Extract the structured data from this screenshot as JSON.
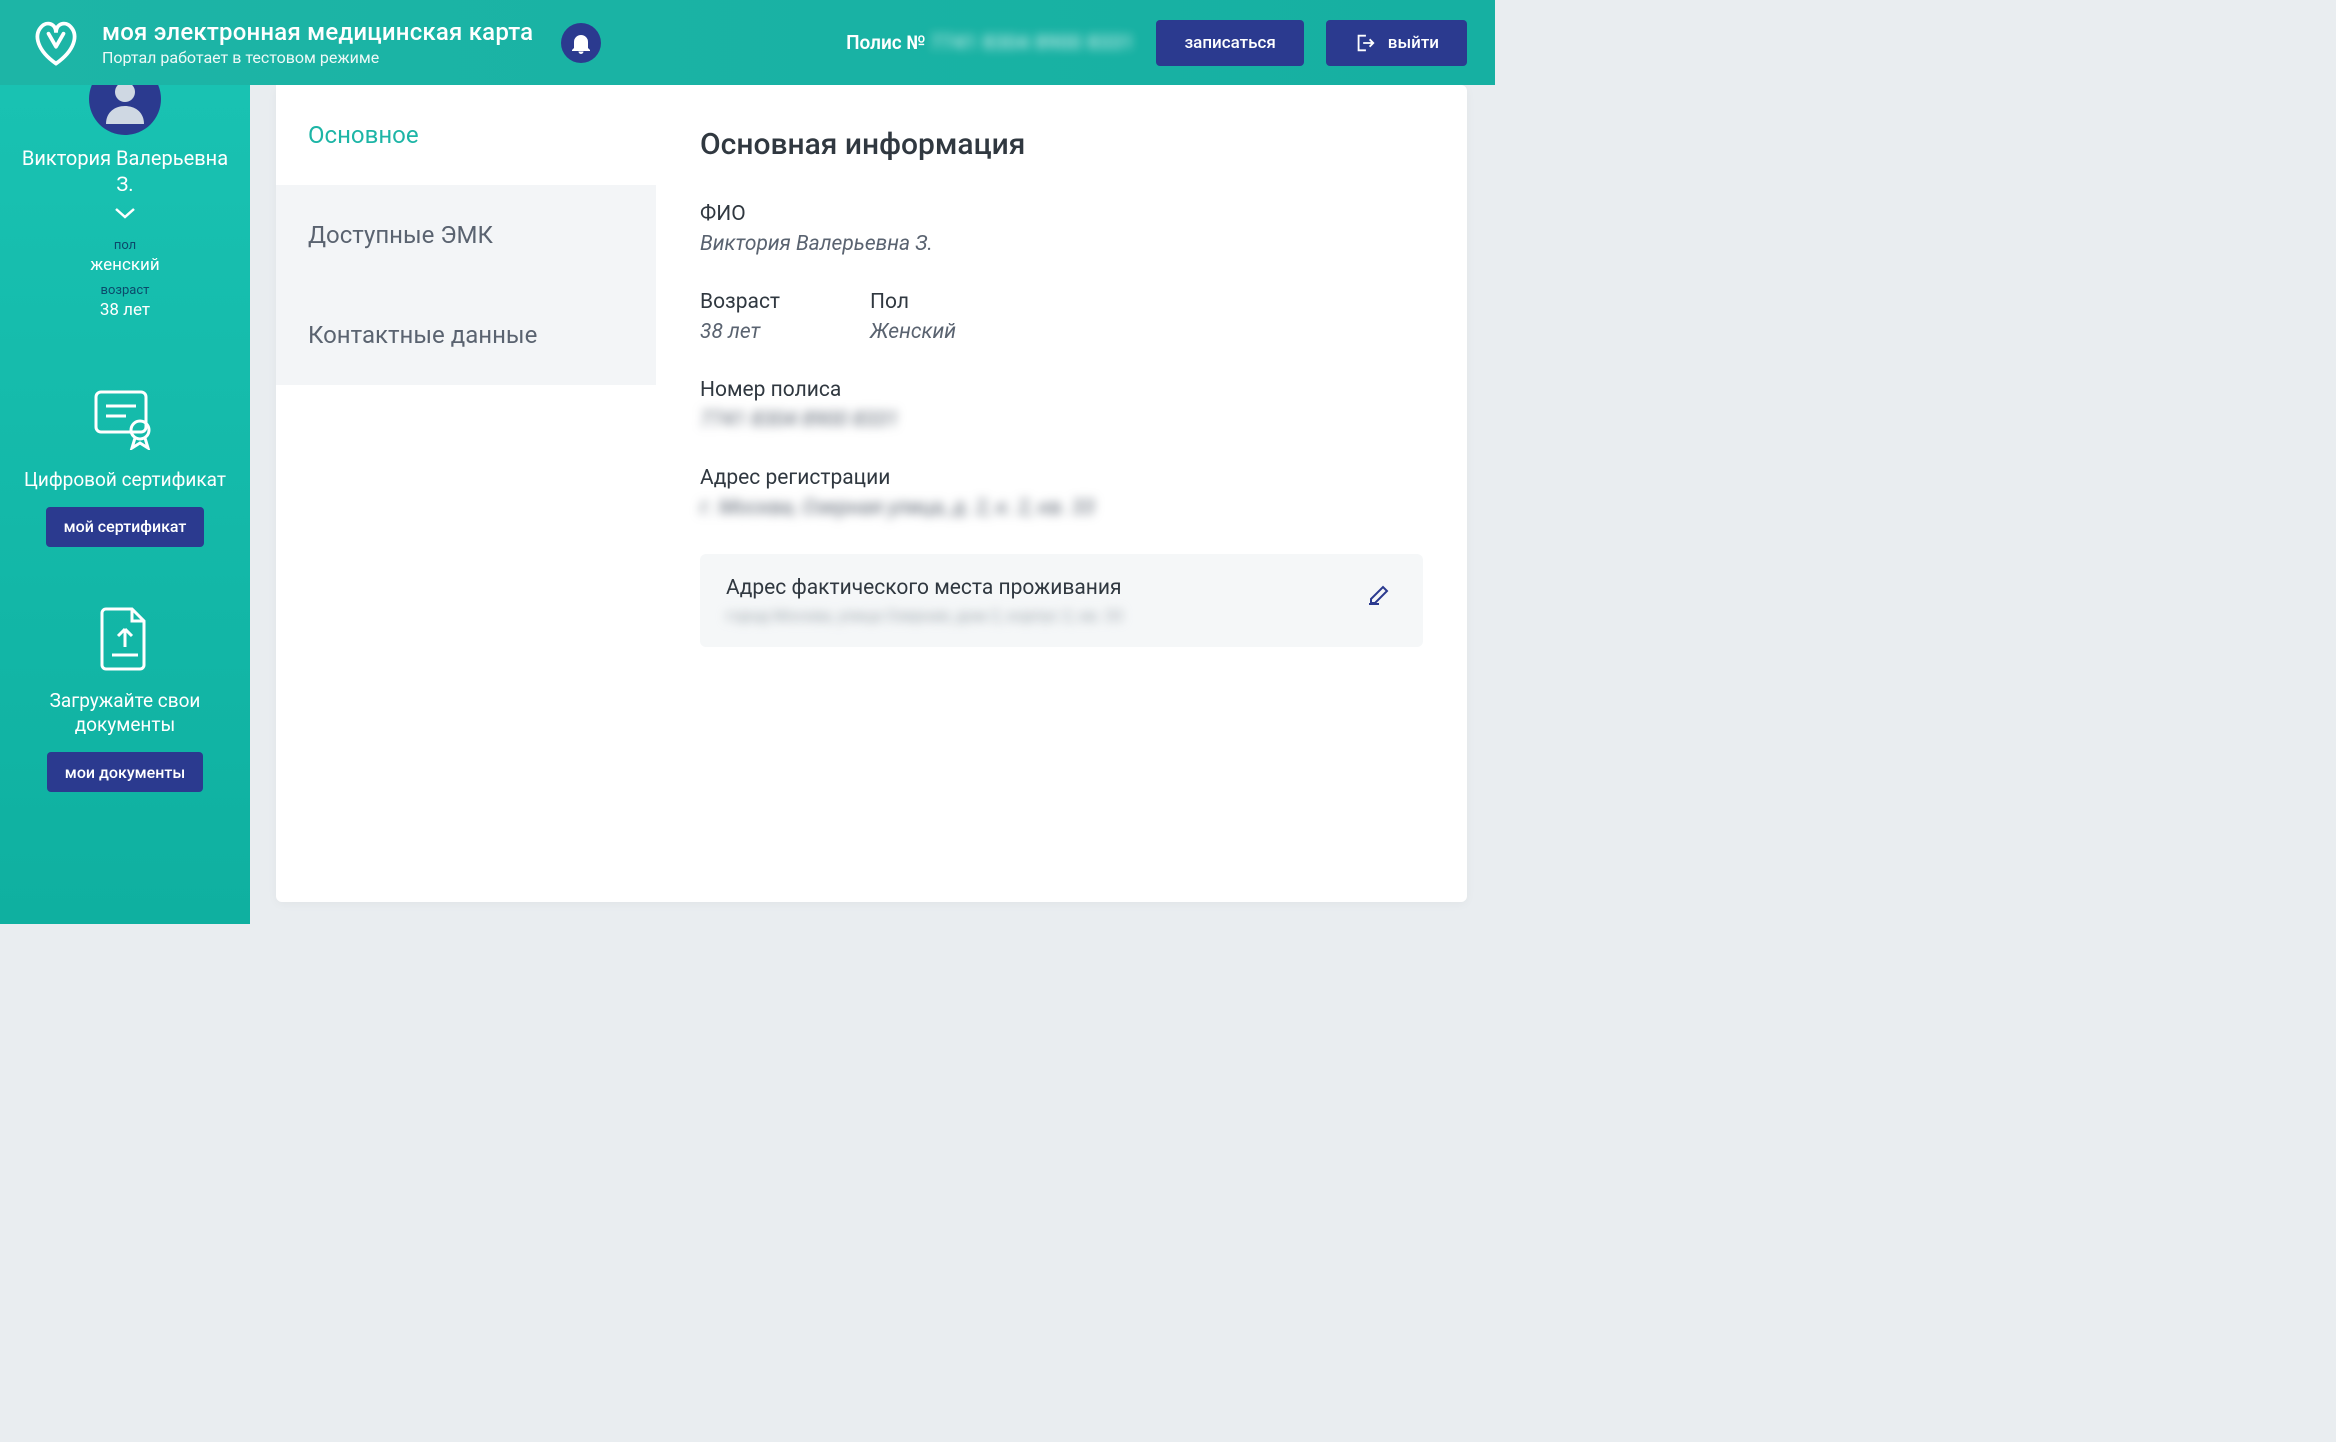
{
  "header": {
    "title": "моя электронная медицинская карта",
    "subtitle": "Портал работает в тестовом режиме",
    "policy_label": "Полис №",
    "policy_number": "7741 8304 8900 8331",
    "book_btn": "записаться",
    "logout_btn": "выйти"
  },
  "sidebar": {
    "user_name": "Виктория Валерьевна З.",
    "gender_label": "пол",
    "gender": "женский",
    "age_label": "возраст",
    "age": "38 лет",
    "cert_title": "Цифровой сертификат",
    "cert_btn": "мой сертификат",
    "docs_title": "Загружайте свои документы",
    "docs_btn": "мои документы"
  },
  "tabs": {
    "main": "Основное",
    "emk": "Доступные ЭМК",
    "contact": "Контактные данные"
  },
  "content": {
    "heading": "Основная информация",
    "fio_label": "ФИО",
    "fio": "Виктория Валерьевна З.",
    "age_label": "Возраст",
    "age": "38 лет",
    "gender_label": "Пол",
    "gender": "Женский",
    "policy_label": "Номер полиса",
    "policy": "7741 8304 8900 8331",
    "reg_label": "Адрес регистрации",
    "reg": "г. Москва, Озерная улица, д. 2, к. 2, кв. 33",
    "act_label": "Адрес фактического места проживания",
    "act": "город Москва, улица Озерная, дом 2, корпус 2, кв. 33"
  }
}
